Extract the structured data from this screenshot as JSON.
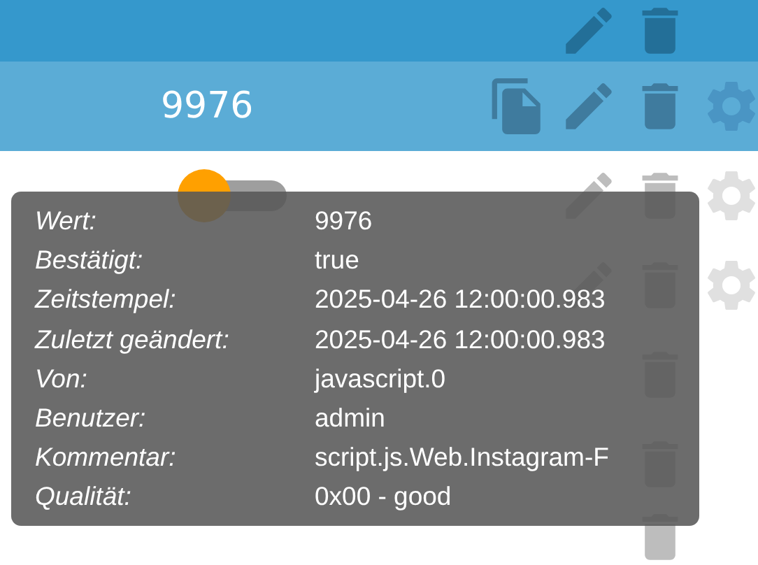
{
  "rows": [
    {
      "selected": true,
      "hovered": false,
      "kind": "empty",
      "actions": [
        {
          "kind": "edit"
        },
        {
          "kind": "delete"
        }
      ]
    },
    {
      "selected": false,
      "hovered": true,
      "kind": "text",
      "value": "9976",
      "actions": [
        {
          "kind": "copy"
        },
        {
          "kind": "edit"
        },
        {
          "kind": "delete"
        },
        {
          "kind": "settings"
        }
      ]
    },
    {
      "selected": false,
      "hovered": false,
      "kind": "toggle",
      "on": false,
      "actions": [
        {
          "kind": "edit"
        },
        {
          "kind": "delete"
        },
        {
          "kind": "settings"
        }
      ]
    },
    {
      "selected": false,
      "hovered": false,
      "kind": "empty",
      "actions": [
        {
          "kind": "edit"
        },
        {
          "kind": "delete"
        },
        {
          "kind": "settings"
        }
      ]
    },
    {
      "selected": false,
      "hovered": false,
      "kind": "empty",
      "actions": [
        {
          "kind": "delete"
        }
      ]
    },
    {
      "selected": false,
      "hovered": false,
      "kind": "empty",
      "actions": [
        {
          "kind": "delete"
        }
      ]
    },
    {
      "selected": false,
      "hovered": false,
      "kind": "empty",
      "actions": [
        {
          "kind": "delete"
        }
      ]
    }
  ],
  "tooltip": {
    "fields": [
      {
        "label": "Wert:",
        "value": "9976"
      },
      {
        "label": "Bestätigt:",
        "value": "true"
      },
      {
        "label": "Zeitstempel:",
        "value": "2025-04-26 12:00:00.983"
      },
      {
        "label": "Zuletzt geändert:",
        "value": "2025-04-26 12:00:00.983"
      },
      {
        "label": "Von:",
        "value": "javascript.0"
      },
      {
        "label": "Benutzer:",
        "value": "admin"
      },
      {
        "label": "Kommentar:",
        "value": "script.js.Web.Instagram-F"
      },
      {
        "label": "Qualität:",
        "value": "0x00 - good"
      }
    ]
  }
}
